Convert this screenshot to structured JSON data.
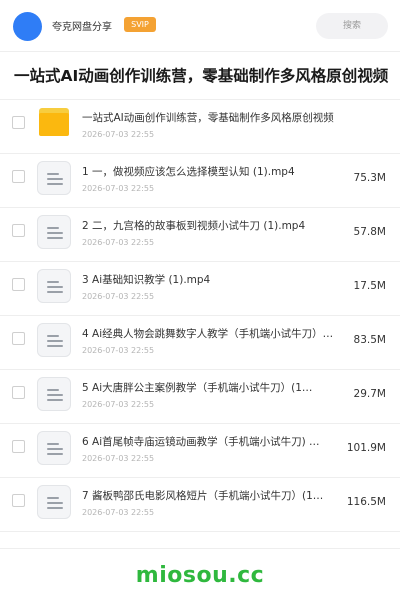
{
  "header": {
    "app_name": "夸克网盘分享",
    "badge": "SVIP",
    "search_placeholder": "搜索"
  },
  "page": {
    "title": "一站式AI动画创作训练营，零基础制作多风格原创视频",
    "title_size": "1M"
  },
  "files": [
    {
      "type": "folder",
      "name": "一站式AI动画创作训练营，零基础制作多风格原创视频",
      "date": "2026-07-03 22:55",
      "size": ""
    },
    {
      "type": "file",
      "name": "1 一，做视频应该怎么选择模型认知 (1).mp4",
      "date": "2026-07-03 22:55",
      "size": "75.3M"
    },
    {
      "type": "file",
      "name": "2 二，九宫格的故事板到视频小试牛刀 (1).mp4",
      "date": "2026-07-03 22:55",
      "size": "57.8M"
    },
    {
      "type": "file",
      "name": "3 Ai基础知识教学 (1).mp4",
      "date": "2026-07-03 22:55",
      "size": "17.5M"
    },
    {
      "type": "file",
      "name": "4 Ai经典人物会跳舞数字人教学（手机端小试牛刀）…",
      "date": "2026-07-03 22:55",
      "size": "83.5M"
    },
    {
      "type": "file",
      "name": "5 Ai大唐胖公主案例教学（手机端小试牛刀）(1…",
      "date": "2026-07-03 22:55",
      "size": "29.7M"
    },
    {
      "type": "file",
      "name": "6 Ai首尾帧寺庙运镜动画教学（手机端小试牛刀) …",
      "date": "2026-07-03 22:55",
      "size": "101.9M"
    },
    {
      "type": "file",
      "name": "7 酱板鸭邵氏电影风格短片（手机端小试牛刀）(1…",
      "date": "2026-07-03 22:55",
      "size": "116.5M"
    }
  ],
  "footer": {
    "watermark": "miosou.cc"
  },
  "colors": {
    "avatar": "#2f7df6",
    "badge": "#f4a233",
    "watermark": "#2fb83e",
    "folder": "#fbb80f"
  },
  "icons": {
    "folder": "folder-icon",
    "file": "document-icon",
    "checkbox": "checkbox-icon"
  }
}
